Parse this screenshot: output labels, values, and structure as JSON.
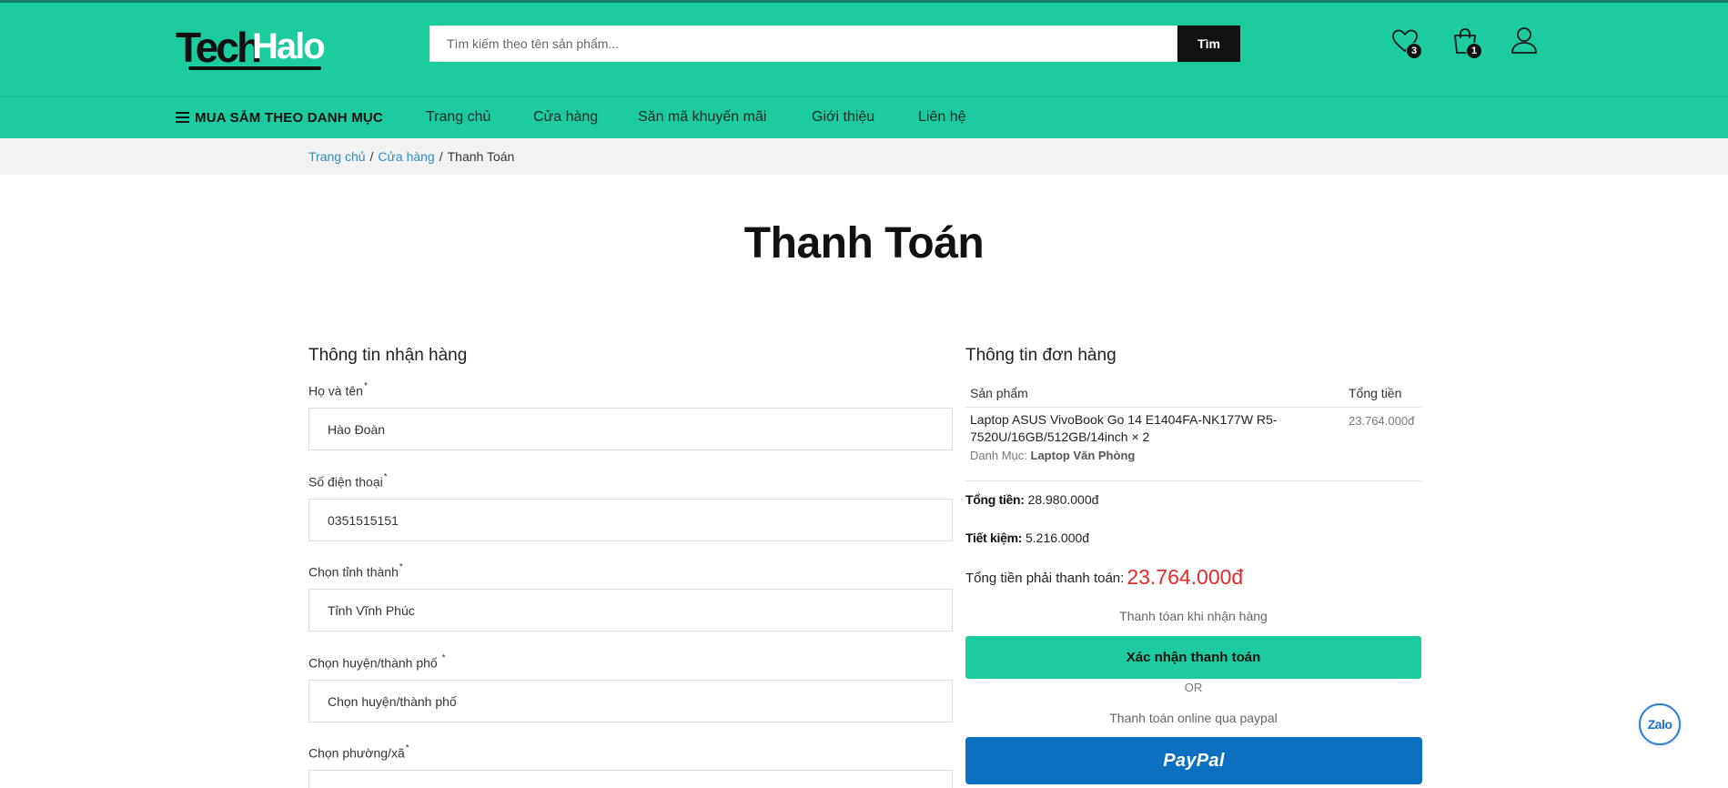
{
  "header": {
    "logo_part1": "Tech",
    "logo_part2": "Halo",
    "search_placeholder": "Tìm kiếm theo tên sản phẩm...",
    "search_button": "Tìm",
    "wishlist_count": "3",
    "cart_count": "1",
    "accent_color": "#1ccb9e"
  },
  "nav": {
    "category_menu": "MUA SẮM THEO DANH MỤC",
    "items": [
      "Trang chủ",
      "Cửa hàng",
      "Săn mã khuyến mãi",
      "Giới thiệu",
      "Liên hệ"
    ]
  },
  "breadcrumb": {
    "home": "Trang chủ",
    "shop": "Cửa hàng",
    "separator": "/",
    "current": "Thanh Toán"
  },
  "page_title": "Thanh Toán",
  "shipping": {
    "title": "Thông tin nhận hàng",
    "fields": [
      {
        "label": "Họ và tên",
        "required": "*",
        "value": "Hào Đoàn"
      },
      {
        "label": "Số điện thoại",
        "required": "*",
        "value": "0351515151"
      },
      {
        "label": "Chọn tỉnh thành",
        "required": "*",
        "value": "Tỉnh Vĩnh Phúc"
      },
      {
        "label": "Chọn huyện/thành phố ",
        "required": "*",
        "value": "Chọn huyện/thành phố"
      },
      {
        "label": "Chọn phường/xã",
        "required": "*",
        "value": ""
      }
    ]
  },
  "order": {
    "title": "Thông tin đơn hàng",
    "col_product": "Sản phẩm",
    "col_total": "Tổng tiền",
    "item": {
      "name": "Laptop ASUS VivoBook Go 14 E1404FA-NK177W R5-7520U/16GB/512GB/14inch × 2",
      "category_label": "Danh Mục:",
      "category": "Laptop Văn Phòng",
      "total": "23.764.000đ"
    },
    "subtotal_label": "Tổng tiền:",
    "subtotal": "28.980.000đ",
    "savings_label": "Tiết kiệm:",
    "savings": "5.216.000đ",
    "grand_label": "Tổng tiền phải thanh toán:",
    "grand_total": "23.764.000đ",
    "grand_color": "#e02b2b",
    "cod_note": "Thanh tóan khi nhận hàng",
    "confirm_button": "Xác nhận thanh toán",
    "or": "OR",
    "paypal_note": "Thanh toán online qua paypal",
    "paypal_button": "PayPal"
  },
  "chat_widget": "Zalo"
}
